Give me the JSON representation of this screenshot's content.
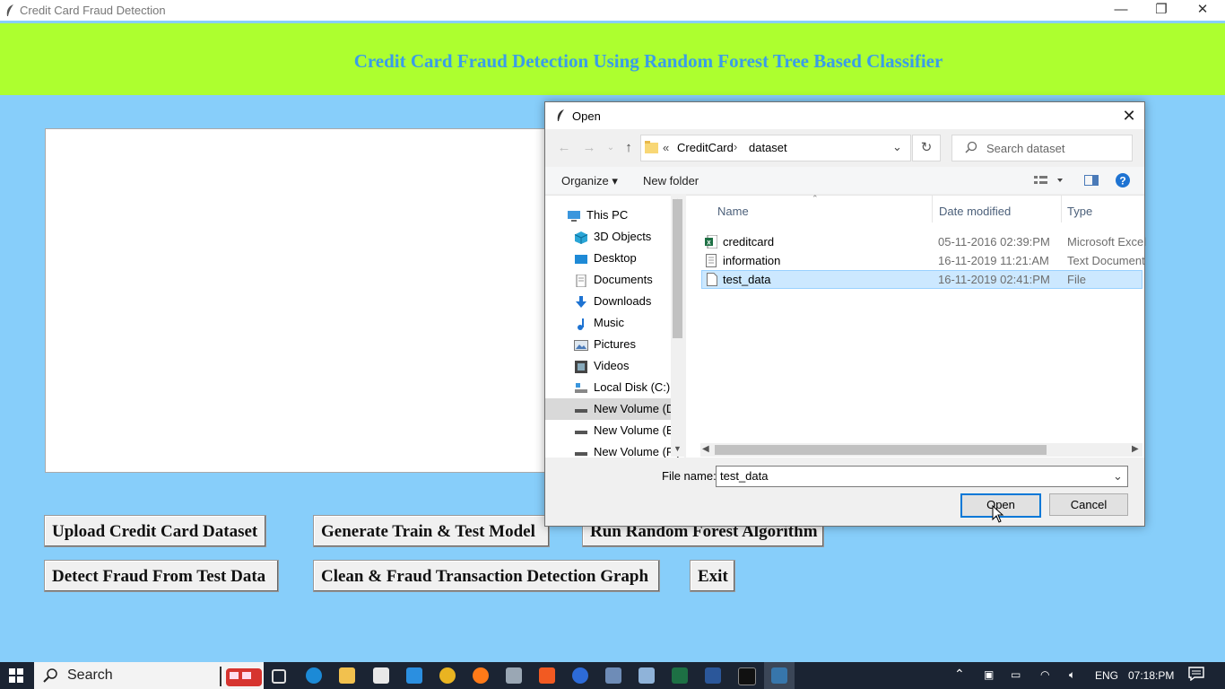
{
  "window": {
    "title": "Credit Card Fraud Detection"
  },
  "app": {
    "heading": "Credit Card Fraud Detection Using Random Forest Tree Based Classifier",
    "buttons": {
      "upload": "Upload Credit Card Dataset",
      "generate": "Generate Train & Test Model",
      "run_rf": "Run Random Forest Algorithm",
      "detect": "Detect Fraud From Test Data",
      "graph": "Clean & Fraud Transaction Detection Graph",
      "exit": "Exit"
    }
  },
  "dialog": {
    "title": "Open",
    "breadcrumb": {
      "sep": "«",
      "parts": [
        "CreditCard",
        "dataset"
      ]
    },
    "search_placeholder": "Search dataset",
    "toolbar": {
      "organize": "Organize ▾",
      "new_folder": "New folder"
    },
    "nav": [
      {
        "label": "This PC",
        "icon": "pc-icon"
      },
      {
        "label": "3D Objects",
        "icon": "cube-icon"
      },
      {
        "label": "Desktop",
        "icon": "desktop-icon"
      },
      {
        "label": "Documents",
        "icon": "documents-icon"
      },
      {
        "label": "Downloads",
        "icon": "download-icon"
      },
      {
        "label": "Music",
        "icon": "music-icon"
      },
      {
        "label": "Pictures",
        "icon": "pictures-icon"
      },
      {
        "label": "Videos",
        "icon": "videos-icon"
      },
      {
        "label": "Local Disk (C:)",
        "icon": "drive-icon"
      },
      {
        "label": "New Volume (D:",
        "icon": "drive-icon"
      },
      {
        "label": "New Volume (E:)",
        "icon": "drive-icon"
      },
      {
        "label": "New Volume (F:)",
        "icon": "drive-icon"
      }
    ],
    "columns": {
      "name": "Name",
      "date": "Date modified",
      "type": "Type"
    },
    "files": [
      {
        "name": "creditcard",
        "date": "05-11-2016 02:39:PM",
        "type": "Microsoft Excel",
        "icon": "excel-file-icon"
      },
      {
        "name": "information",
        "date": "16-11-2019 11:21:AM",
        "type": "Text Document",
        "icon": "text-file-icon"
      },
      {
        "name": "test_data",
        "date": "16-11-2019 02:41:PM",
        "type": "File",
        "icon": "file-icon"
      }
    ],
    "selected_file": "test_data",
    "filename_label": "File name:",
    "filename_value": "test_data",
    "open_label": "Open",
    "cancel_label": "Cancel"
  },
  "taskbar": {
    "search_label": "Search",
    "lang": "ENG",
    "time": "07:18:PM"
  }
}
